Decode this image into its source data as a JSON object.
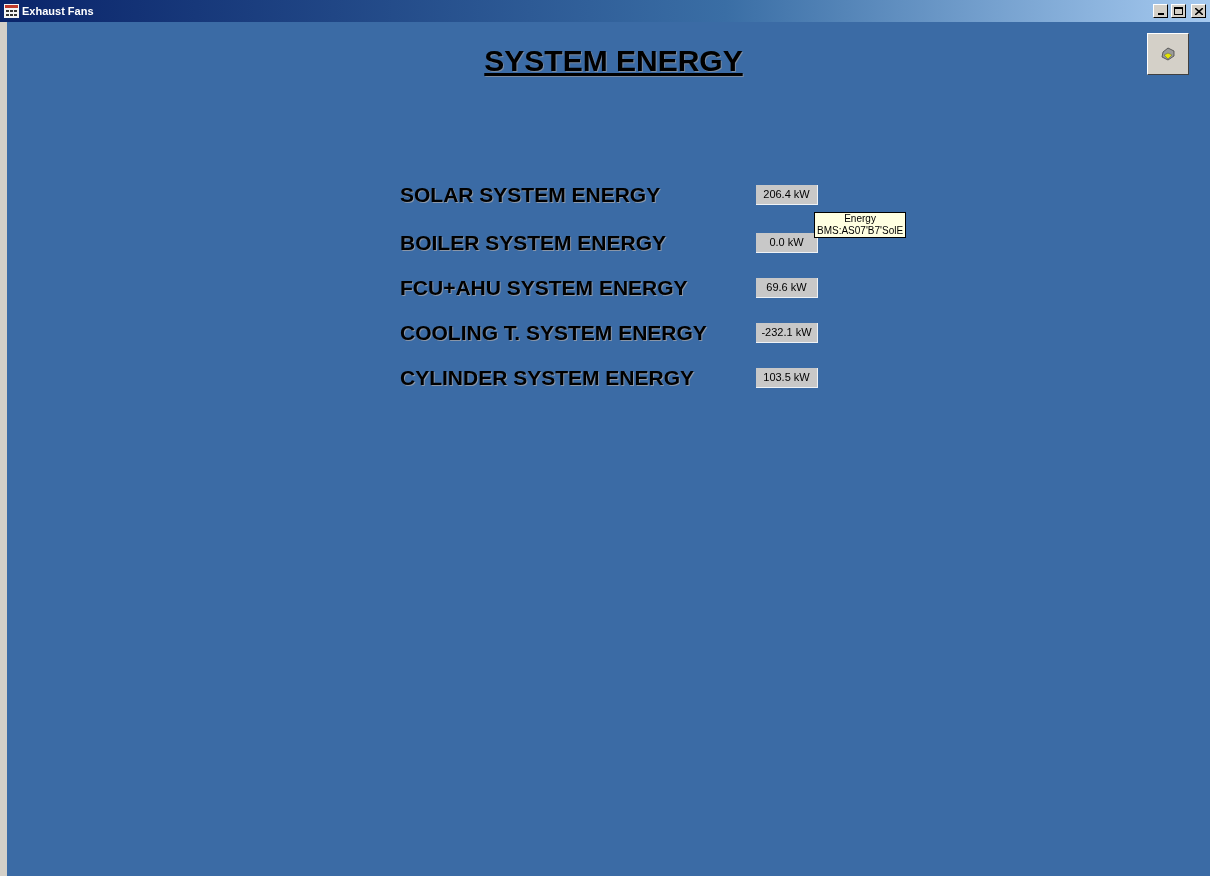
{
  "window": {
    "title": "Exhaust Fans"
  },
  "page_title": "SYSTEM ENERGY",
  "rows": [
    {
      "label": "SOLAR SYSTEM ENERGY",
      "value": "206.4 kW"
    },
    {
      "label": "BOILER SYSTEM ENERGY",
      "value": "0.0 kW",
      "tooltip": {
        "lines": [
          "Energy",
          "BMS:AS07'B7'SolE"
        ]
      }
    },
    {
      "label": "FCU+AHU SYSTEM ENERGY",
      "value": "69.6 kW"
    },
    {
      "label": "COOLING T. SYSTEM ENERGY",
      "value": "-232.1 kW"
    },
    {
      "label": "CYLINDER SYSTEM ENERGY",
      "value": "103.5 kW"
    }
  ]
}
